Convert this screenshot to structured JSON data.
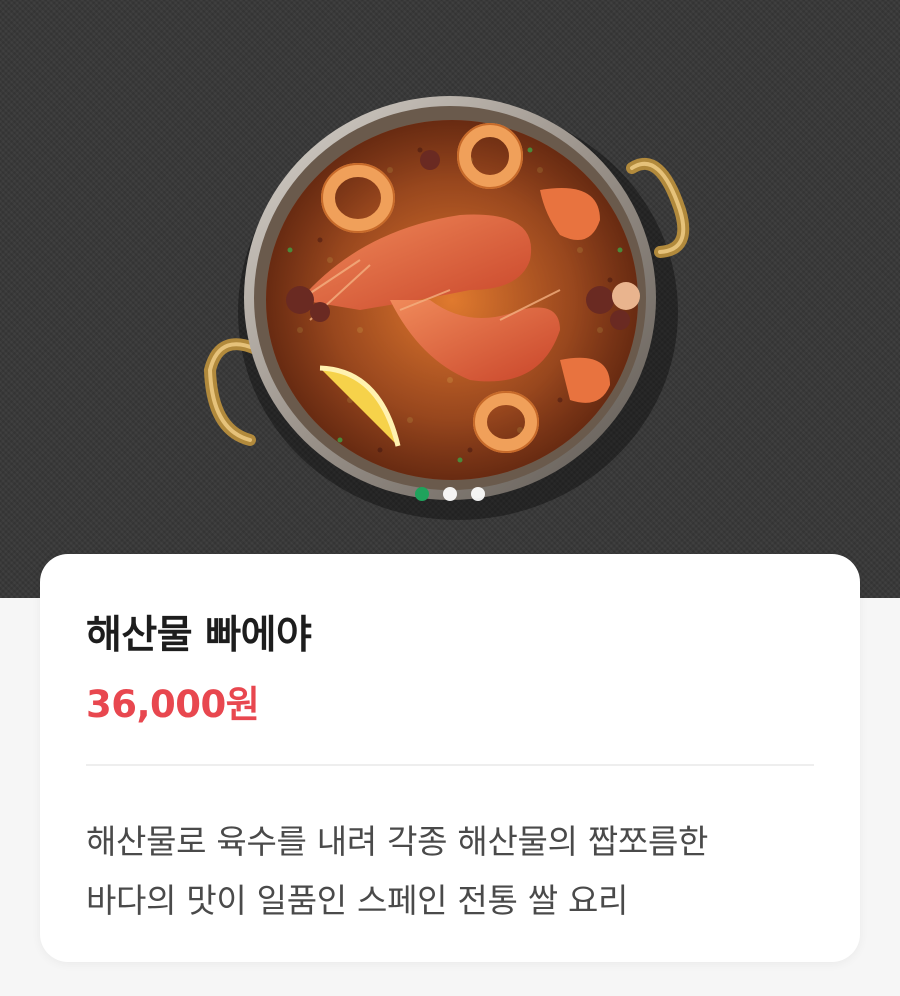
{
  "carousel": {
    "slide_count": 3,
    "active_index": 0,
    "accent": "#1fa35c"
  },
  "product": {
    "name": "해산물 빠에야",
    "price": "36,000원",
    "description_line1": "해산물로 육수를 내려 각종 해산물의 짭쪼름한",
    "description_line2": "바다의 맛이 일품인 스페인 전통 쌀 요리"
  },
  "colors": {
    "price": "#e8474f",
    "background": "#f6f6f6",
    "card": "#ffffff"
  }
}
